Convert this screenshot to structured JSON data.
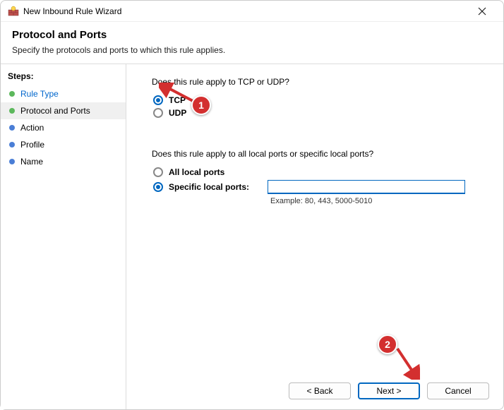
{
  "window": {
    "title": "New Inbound Rule Wizard"
  },
  "header": {
    "title": "Protocol and Ports",
    "subtitle": "Specify the protocols and ports to which this rule applies."
  },
  "sidebar": {
    "header": "Steps:",
    "items": [
      {
        "label": "Rule Type",
        "state": "prev"
      },
      {
        "label": "Protocol and Ports",
        "state": "current"
      },
      {
        "label": "Action",
        "state": "pending"
      },
      {
        "label": "Profile",
        "state": "pending"
      },
      {
        "label": "Name",
        "state": "pending"
      }
    ]
  },
  "content": {
    "question_protocol": "Does this rule apply to TCP or UDP?",
    "protocol_options": {
      "tcp": "TCP",
      "udp": "UDP"
    },
    "protocol_selected": "tcp",
    "question_ports": "Does this rule apply to all local ports or specific local ports?",
    "port_options": {
      "all": "All local ports",
      "specific": "Specific local ports:"
    },
    "port_selected": "specific",
    "port_value": "",
    "port_example": "Example: 80, 443, 5000-5010"
  },
  "footer": {
    "back": "< Back",
    "next": "Next >",
    "cancel": "Cancel"
  },
  "annotations": {
    "badge1": "1",
    "badge2": "2"
  }
}
